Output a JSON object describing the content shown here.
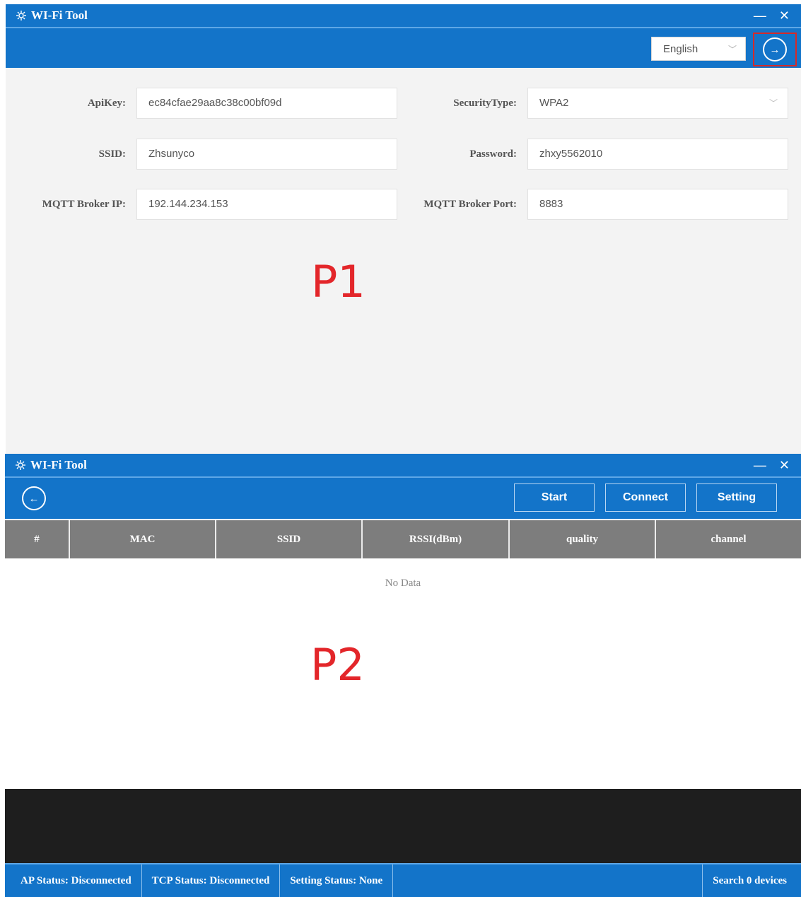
{
  "window1": {
    "title": "WI-Fi Tool",
    "controls": {
      "minimize": "—",
      "close": "✕"
    },
    "language": "English",
    "next_icon": "→",
    "fields": {
      "apikey": {
        "label": "ApiKey:",
        "value": "ec84cfae29aa8c38c00bf09d"
      },
      "security": {
        "label": "SecurityType:",
        "value": "WPA2"
      },
      "ssid": {
        "label": "SSID:",
        "value": "Zhsunyco"
      },
      "password": {
        "label": "Password:",
        "value": "zhxy5562010"
      },
      "broker_ip": {
        "label": "MQTT Broker IP:",
        "value": "192.144.234.153"
      },
      "broker_port": {
        "label": "MQTT Broker Port:",
        "value": "8883"
      }
    },
    "marker": "P1"
  },
  "window2": {
    "title": "WI-Fi Tool",
    "controls": {
      "minimize": "—",
      "close": "✕"
    },
    "back_icon": "←",
    "buttons": {
      "start": "Start",
      "connect": "Connect",
      "setting": "Setting"
    },
    "columns": [
      "#",
      "MAC",
      "SSID",
      "RSSI(dBm)",
      "quality",
      "channel"
    ],
    "empty_text": "No Data",
    "marker": "P2",
    "status": {
      "ap": "AP Status: Disconnected",
      "tcp": "TCP Status: Disconnected",
      "setting": "Setting Status: None",
      "search": "Search 0 devices"
    }
  },
  "colors": {
    "accent": "#1374c9",
    "header_gray": "#7d7d7d",
    "marker_red": "#e3262a",
    "console": "#1e1e1e"
  }
}
